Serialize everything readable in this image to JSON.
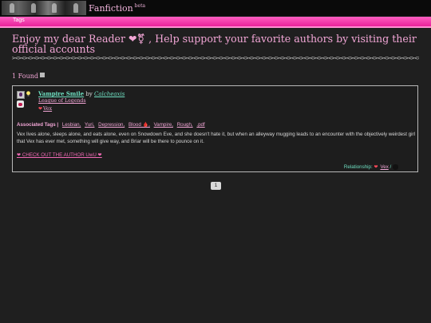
{
  "header": {
    "brand": "Fanfiction",
    "brand_superscript": "beta"
  },
  "nav": {
    "tags_link": "Tags"
  },
  "headline": "Enjoy my dear Reader ❤⚧ , Help support your favorite authors by visiting their official accounts",
  "divider": "><><><><><><><><><><><><><><><><><><><><><><><><><><><><><><><><><><><><><><><><><><><><><><><><><><><><><><><><><><><><><><><><><><><><><><><><><><><><><><><><><><><><><><><><><><><><><>",
  "results": {
    "found_text": "1 Found"
  },
  "story": {
    "title": "Vampire Smile",
    "by": "by",
    "author": "Calcheaxis",
    "fandom": "League of Legends",
    "character": "Vex",
    "tags_label": "Associated Tags |",
    "tags": [
      "Lesbian,",
      "Yuri,",
      "Depression,",
      "Blood 🩸,",
      "Vampire,",
      "Rough,",
      ".pdf"
    ],
    "summary": "Vex lives alone, sleeps alone, and eats alone, even on Snowdown Eve, and she doesn't hate it, but when an alleyway mugging leads to an encounter with the objectively weirdest girl that Vex has ever met, something will give way, and Briar will be there to pounce on it.",
    "checkout_link": "❤ CHECK OUT THE AUTHOR UwU ❤",
    "relationship_label": "Relationship:",
    "relationship_name": "Vex",
    "relationship_sep": "/"
  },
  "pagination": {
    "current_page": "1"
  },
  "colors": {
    "accent_pink": "#f2a6d6",
    "nav_pink": "#e8239a",
    "link_teal": "#6fe0c2",
    "background": "#1f1f1f"
  }
}
